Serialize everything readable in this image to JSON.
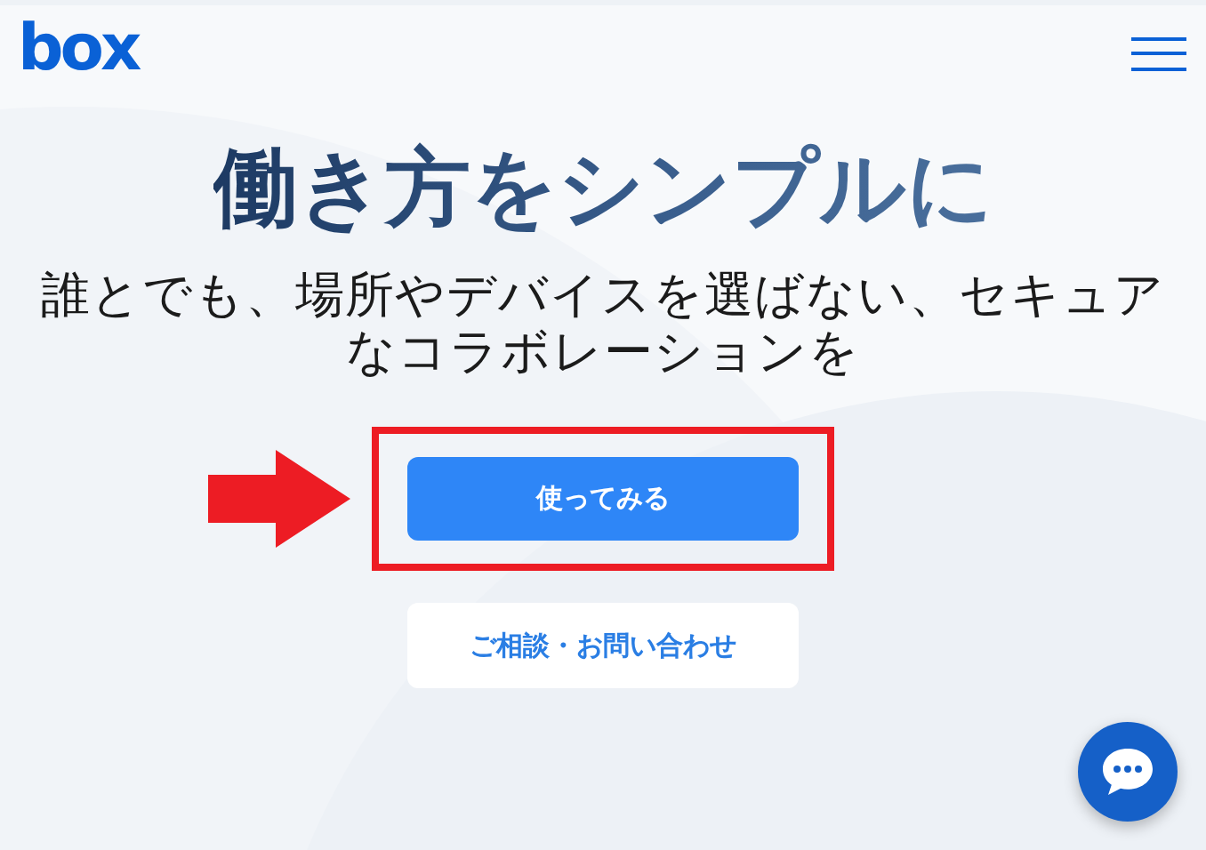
{
  "header": {
    "logo": "box"
  },
  "hero": {
    "title": "働き方をシンプルに",
    "subtitle": "誰とでも、場所やデバイスを選ばない、セキュアなコラボレーションを"
  },
  "actions": [
    {
      "kind": "primary",
      "label": "使ってみる",
      "highlighted": true
    },
    {
      "kind": "secondary",
      "label": "ご相談・お問い合わせ",
      "highlighted": false
    }
  ]
}
